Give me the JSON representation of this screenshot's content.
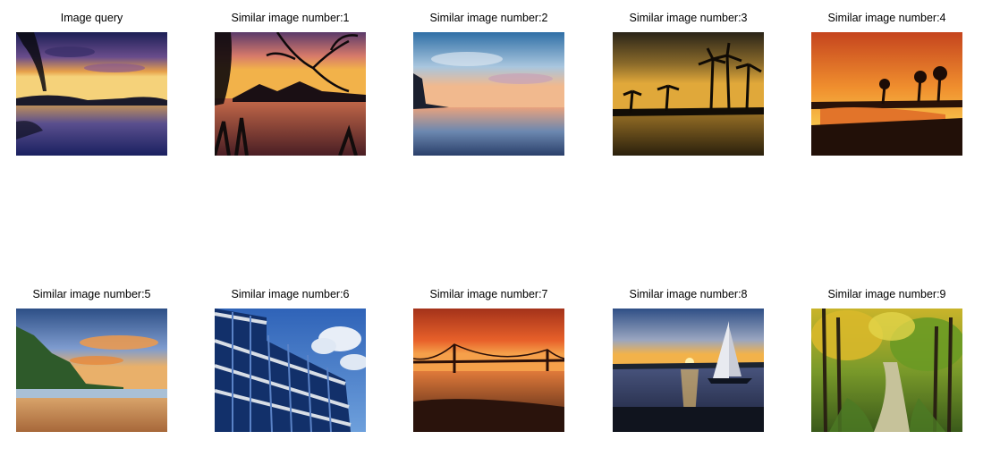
{
  "figure": {
    "rows": [
      [
        {
          "caption": "Image query",
          "scene": "sunset-lake-palm-icon"
        },
        {
          "caption": "Similar image number:1",
          "scene": "sunset-branches-icon"
        },
        {
          "caption": "Similar image number:2",
          "scene": "blue-sky-coast-icon"
        },
        {
          "caption": "Similar image number:3",
          "scene": "palm-silhouette-sunset-icon"
        },
        {
          "caption": "Similar image number:4",
          "scene": "orange-sunset-pool-icon"
        }
      ],
      [
        {
          "caption": "Similar image number:5",
          "scene": "tropical-beach-cliff-icon"
        },
        {
          "caption": "Similar image number:6",
          "scene": "glass-building-icon"
        },
        {
          "caption": "Similar image number:7",
          "scene": "sunset-bridge-icon"
        },
        {
          "caption": "Similar image number:8",
          "scene": "sailboat-sunset-icon"
        },
        {
          "caption": "Similar image number:9",
          "scene": "forest-path-icon"
        }
      ]
    ]
  }
}
